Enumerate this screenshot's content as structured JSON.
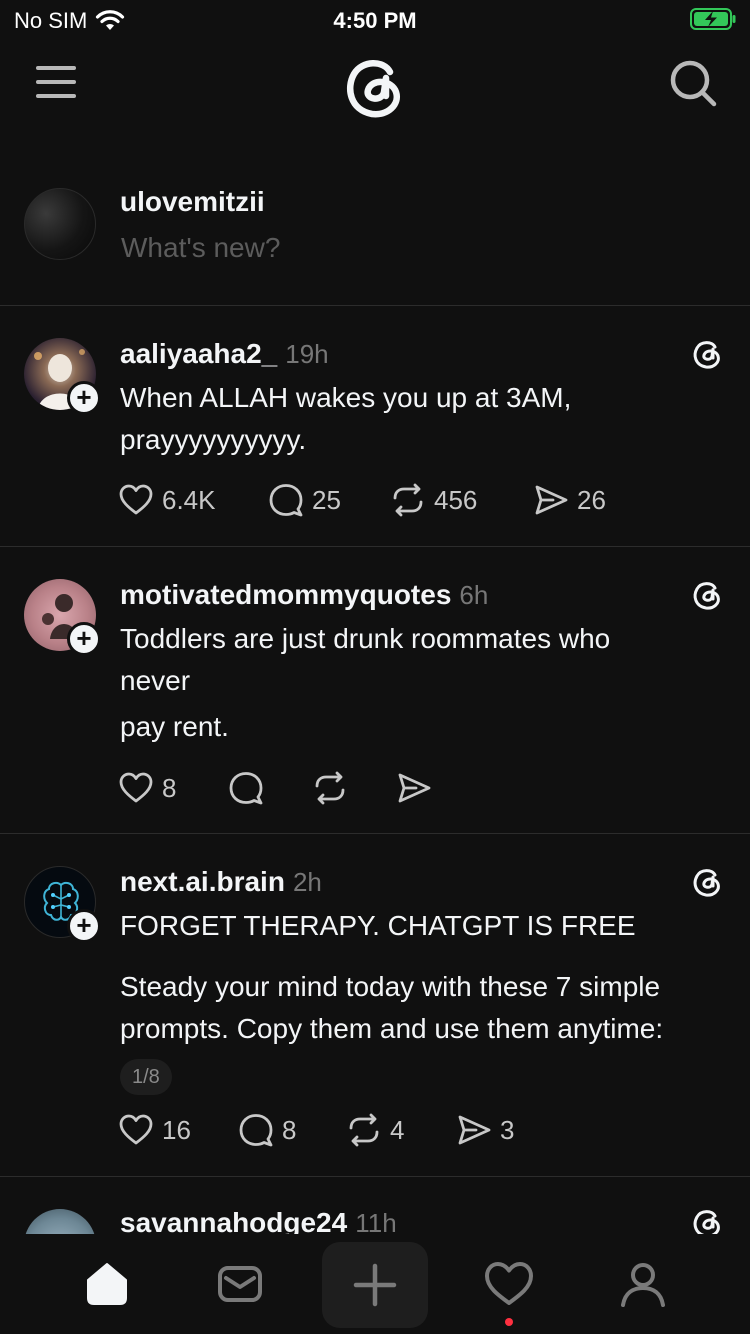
{
  "status_bar": {
    "carrier": "No SIM",
    "time": "4:50 PM",
    "battery_color": "#33c759"
  },
  "top_nav": {
    "menu_icon": "hamburger-menu-icon",
    "logo_icon": "threads-logo-icon",
    "search_icon": "search-icon"
  },
  "composer": {
    "username": "ulovemitzii",
    "placeholder": "What's new?"
  },
  "posts": [
    {
      "username": "aaliyaaha2_",
      "time": "19h",
      "lines": [
        "When ALLAH wakes you up at 3AM,",
        "prayyyyyyyyyy."
      ],
      "likes": "6.4K",
      "replies": "25",
      "reposts": "456",
      "shares": "26"
    },
    {
      "username": "motivatedmommyquotes",
      "time": "6h",
      "lines": [
        "Toddlers are just drunk roommates who",
        "never",
        "pay rent."
      ],
      "likes": "8",
      "replies": "",
      "reposts": "",
      "shares": ""
    },
    {
      "username": "next.ai.brain",
      "time": "2h",
      "lines": [
        "FORGET THERAPY. CHATGPT IS FREE",
        "Steady your mind today with these 7 simple",
        "prompts. Copy them and use them anytime:"
      ],
      "page_indicator": "1/8",
      "likes": "16",
      "replies": "8",
      "reposts": "4",
      "shares": "3"
    },
    {
      "username": "savannahodge24",
      "time": "11h"
    }
  ],
  "bottom_bar": {
    "tabs": [
      "home-icon",
      "inbox-icon",
      "create-icon",
      "activity-icon",
      "profile-icon"
    ],
    "notification_dot_color": "#ff3040"
  }
}
